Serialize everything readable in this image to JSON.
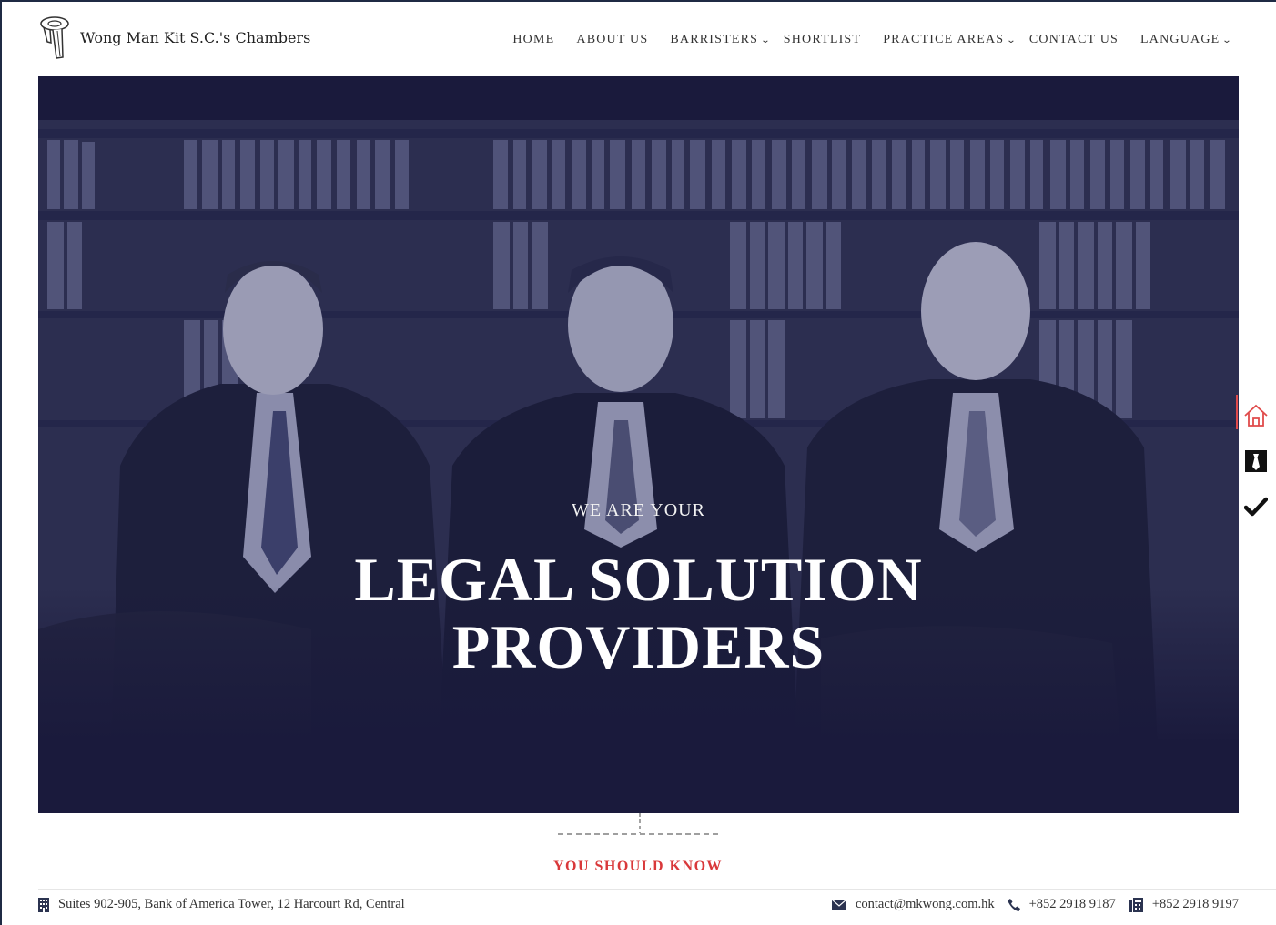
{
  "brand": {
    "name": "Wong Man Kit S.C.'s Chambers"
  },
  "nav": {
    "items": [
      {
        "label": "HOME",
        "has_dropdown": false
      },
      {
        "label": "ABOUT US",
        "has_dropdown": false
      },
      {
        "label": "BARRISTERS",
        "has_dropdown": true
      },
      {
        "label": "SHORTLIST",
        "has_dropdown": false
      },
      {
        "label": "PRACTICE AREAS",
        "has_dropdown": true
      },
      {
        "label": "CONTACT US",
        "has_dropdown": false
      },
      {
        "label": "LANGUAGE",
        "has_dropdown": true
      }
    ]
  },
  "hero": {
    "kicker": "WE ARE YOUR",
    "title_line1": "LEGAL SOLUTION",
    "title_line2": "PROVIDERS"
  },
  "side_toolbar": {
    "items": [
      {
        "icon": "home-icon",
        "active": true
      },
      {
        "icon": "tie-icon",
        "active": false
      },
      {
        "icon": "check-icon",
        "active": false
      }
    ]
  },
  "section": {
    "label": "YOU SHOULD KNOW"
  },
  "footer": {
    "address": "Suites 902-905, Bank of America Tower, 12 Harcourt Rd, Central",
    "email": "contact@mkwong.com.hk",
    "phone": "+852 2918 9187",
    "fax": "+852 2918 9197"
  },
  "colors": {
    "hero_bg": "#1a1a3c",
    "accent_red": "#d9383a",
    "text": "#333333"
  }
}
